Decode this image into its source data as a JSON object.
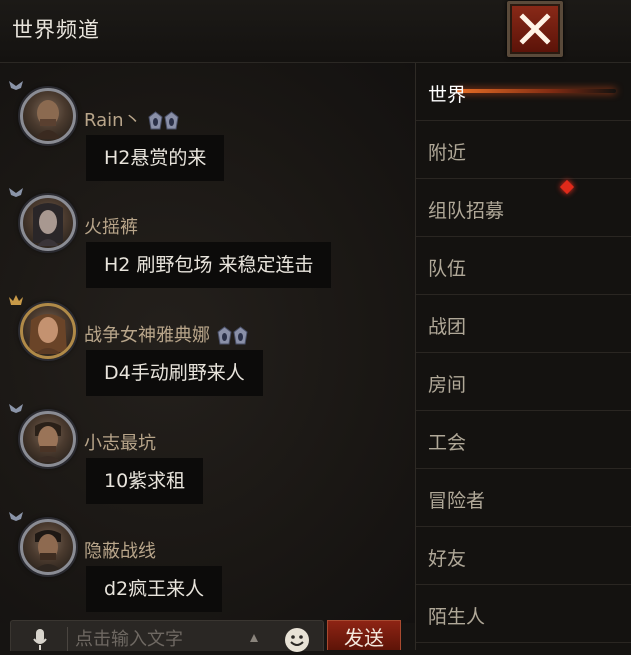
{
  "header": {
    "title": "世界频道",
    "close_icon": "close-x-icon"
  },
  "messages": [
    {
      "name": "Rain丶",
      "text": "H2悬赏的来",
      "badges": 2,
      "rank": "silver"
    },
    {
      "name": "火摇裤",
      "text": "H2 刷野包场 来稳定连击",
      "badges": 0,
      "rank": "silver"
    },
    {
      "name": "战争女神雅典娜",
      "text": "D4手动刷野来人",
      "badges": 2,
      "rank": "gold"
    },
    {
      "name": "小志最坑",
      "text": "10紫求租",
      "badges": 0,
      "rank": "silver"
    },
    {
      "name": "隐蔽战线",
      "text": "d2疯王来人",
      "badges": 0,
      "rank": "silver"
    }
  ],
  "tabs": [
    {
      "label": "世界",
      "active": true
    },
    {
      "label": "附近"
    },
    {
      "label": "组队招募",
      "notification": true
    },
    {
      "label": "队伍"
    },
    {
      "label": "战团"
    },
    {
      "label": "房间"
    },
    {
      "label": "工会"
    },
    {
      "label": "冒险者"
    },
    {
      "label": "好友"
    },
    {
      "label": "陌生人"
    }
  ],
  "input": {
    "placeholder": "点击输入文字",
    "send_label": "发送"
  },
  "colors": {
    "accent": "#8e2414",
    "name": "#b8a58a",
    "active_glow": "#ff7828"
  }
}
